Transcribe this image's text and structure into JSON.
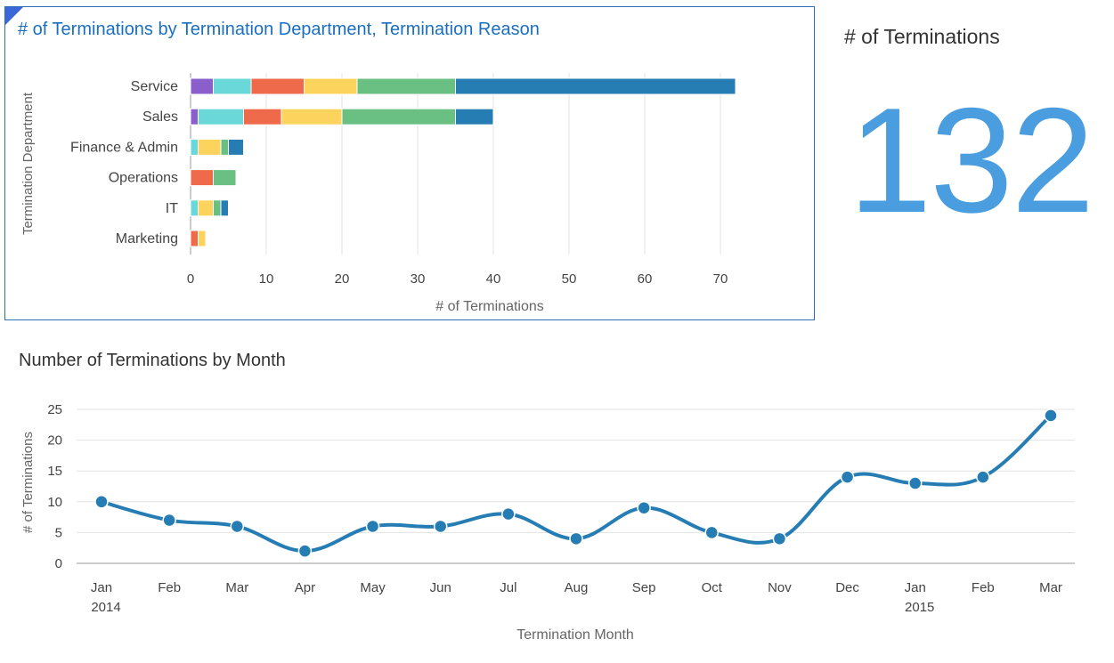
{
  "kpi": {
    "title": "# of Terminations",
    "value": "132"
  },
  "chart_data": [
    {
      "type": "bar",
      "orientation": "horizontal",
      "stacked": true,
      "title": "# of Terminations by Termination Department, Termination Reason",
      "xlabel": "# of Terminations",
      "ylabel": "Termination Department",
      "categories": [
        "Service",
        "Sales",
        "Finance & Admin",
        "Operations",
        "IT",
        "Marketing"
      ],
      "xlim": [
        0,
        72
      ],
      "xticks": [
        "0",
        "10",
        "20",
        "30",
        "40",
        "50",
        "60",
        "70"
      ],
      "grid": true,
      "series": [
        {
          "color": "#8a5fcc",
          "values": [
            3,
            1,
            0,
            0,
            0,
            0
          ]
        },
        {
          "color": "#6ad8d8",
          "values": [
            5,
            6,
            1,
            0,
            1,
            0
          ]
        },
        {
          "color": "#ee6a4b",
          "values": [
            7,
            5,
            0,
            3,
            0,
            1
          ]
        },
        {
          "color": "#fcd35c",
          "values": [
            7,
            8,
            3,
            0,
            2,
            1
          ]
        },
        {
          "color": "#6ac083",
          "values": [
            13,
            15,
            1,
            3,
            1,
            0
          ]
        },
        {
          "color": "#267db4",
          "values": [
            37,
            5,
            2,
            0,
            1,
            0
          ]
        }
      ]
    },
    {
      "type": "line",
      "title": "Number of Terminations by Month",
      "xlabel": "Termination Month",
      "ylabel": "# of Terminations",
      "x": [
        "Jan",
        "Feb",
        "Mar",
        "Apr",
        "May",
        "Jun",
        "Jul",
        "Aug",
        "Sep",
        "Oct",
        "Nov",
        "Dec",
        "Jan",
        "Feb",
        "Mar"
      ],
      "x_year_labels": [
        "2014",
        "",
        "",
        "",
        "",
        "",
        "",
        "",
        "",
        "",
        "",
        "",
        "2015",
        "",
        ""
      ],
      "ylim": [
        0,
        25
      ],
      "yticks": [
        "0",
        "5",
        "10",
        "15",
        "20",
        "25"
      ],
      "grid": true,
      "color": "#267db4",
      "values": [
        10,
        7,
        6,
        2,
        6,
        6,
        8,
        4,
        9,
        5,
        4,
        14,
        13,
        14,
        24
      ]
    }
  ]
}
